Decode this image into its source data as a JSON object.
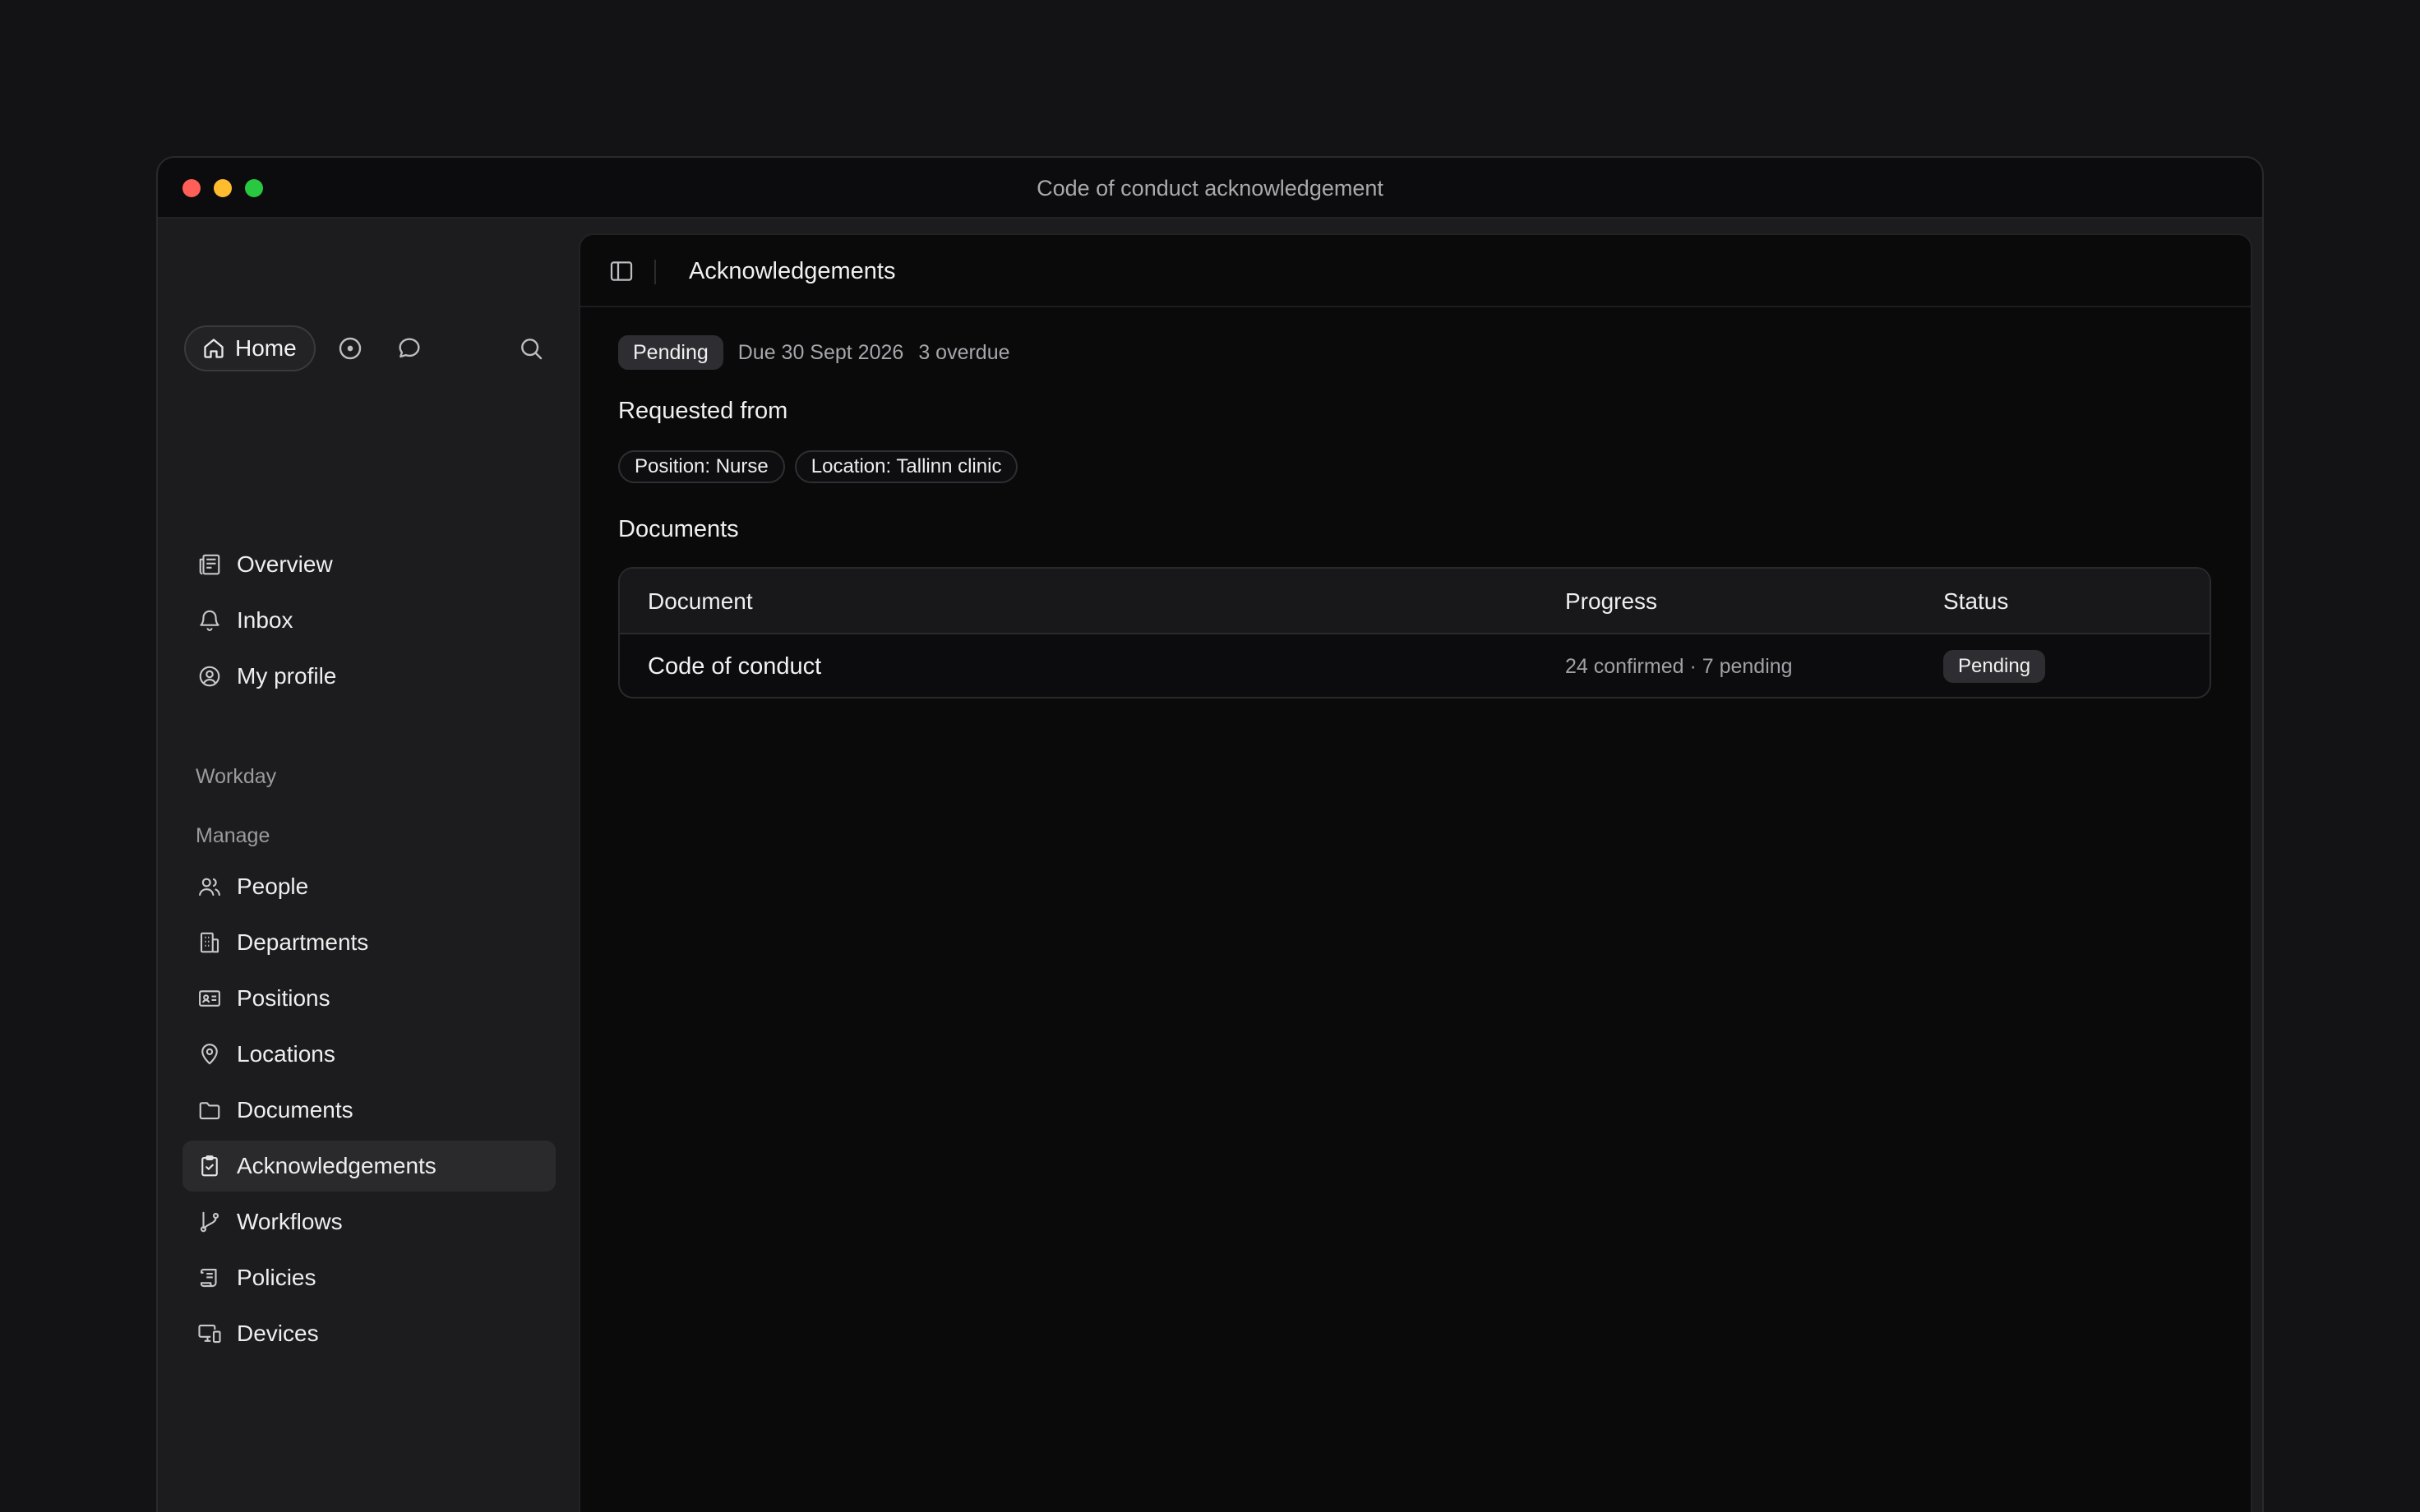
{
  "window": {
    "title": "Code of conduct acknowledgement"
  },
  "sidebar": {
    "home_label": "Home",
    "primary_items": [
      {
        "label": "Overview",
        "icon": "newspaper-icon"
      },
      {
        "label": "Inbox",
        "icon": "bell-icon"
      },
      {
        "label": "My profile",
        "icon": "user-circle-icon"
      }
    ],
    "section_workday": "Workday",
    "section_manage": "Manage",
    "manage_items": [
      {
        "label": "People",
        "icon": "users-icon"
      },
      {
        "label": "Departments",
        "icon": "building-icon"
      },
      {
        "label": "Positions",
        "icon": "id-card-icon"
      },
      {
        "label": "Locations",
        "icon": "map-pin-icon"
      },
      {
        "label": "Documents",
        "icon": "folder-icon"
      },
      {
        "label": "Acknowledgements",
        "icon": "clipboard-check-icon",
        "active": true
      },
      {
        "label": "Workflows",
        "icon": "git-branch-icon"
      },
      {
        "label": "Policies",
        "icon": "scroll-icon"
      },
      {
        "label": "Devices",
        "icon": "monitor-smartphone-icon"
      }
    ]
  },
  "main": {
    "header_title": "Acknowledgements",
    "status_badge": "Pending",
    "due": "Due 30 Sept 2026",
    "overdue": "3 overdue",
    "requested_from_heading": "Requested from",
    "requested_from_chips": [
      "Position: Nurse",
      "Location: Tallinn clinic"
    ],
    "documents_heading": "Documents",
    "table": {
      "columns": [
        "Document",
        "Progress",
        "Status"
      ],
      "rows": [
        {
          "document": "Code of conduct",
          "progress": "24 confirmed · 7 pending",
          "status": "Pending"
        }
      ]
    }
  },
  "colors": {
    "background": "#131315",
    "panel": "#0a0a0b",
    "sidebar": "#1c1c1e",
    "accent_active": "#2a2a2d"
  }
}
